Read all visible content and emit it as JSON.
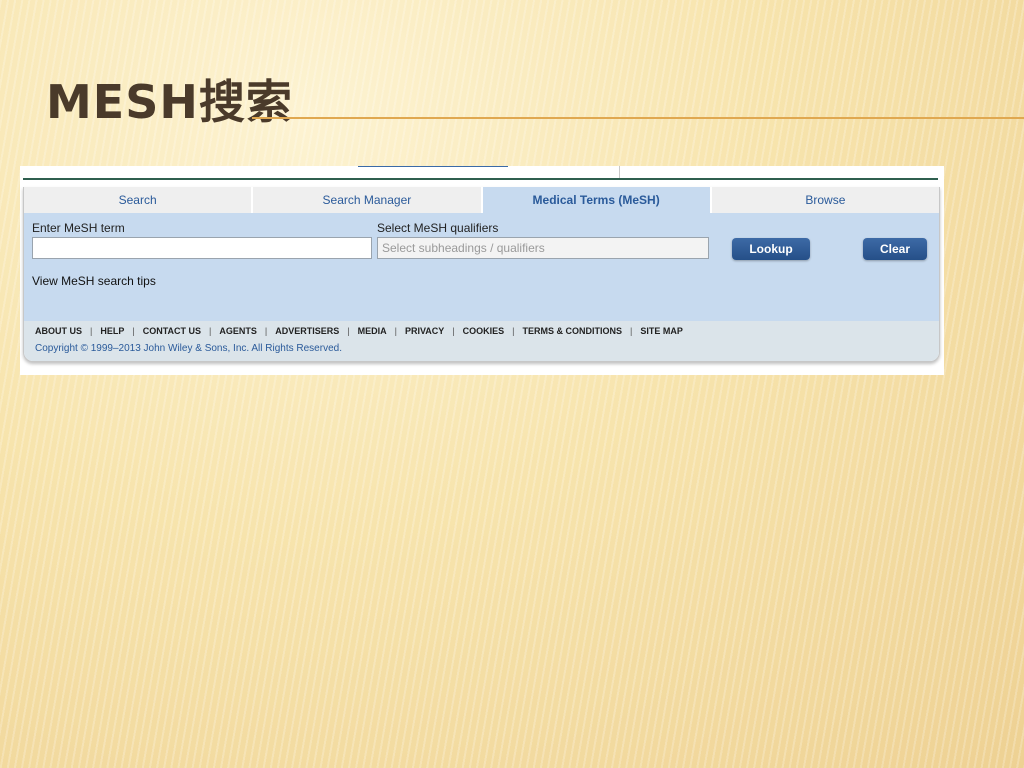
{
  "slide": {
    "title": "MESH搜索"
  },
  "tabs": [
    {
      "label": "Search"
    },
    {
      "label": "Search Manager"
    },
    {
      "label": "Medical Terms (MeSH)"
    },
    {
      "label": "Browse"
    }
  ],
  "form": {
    "term_label": "Enter MeSH term",
    "term_value": "",
    "qualifiers_label": "Select MeSH qualifiers",
    "qualifiers_placeholder": "Select subheadings / qualifiers",
    "lookup_label": "Lookup",
    "clear_label": "Clear",
    "tips_link": "View MeSH search tips"
  },
  "footer": {
    "links": [
      "ABOUT US",
      "HELP",
      "CONTACT US",
      "AGENTS",
      "ADVERTISERS",
      "MEDIA",
      "PRIVACY",
      "COOKIES",
      "TERMS & CONDITIONS",
      "SITE MAP"
    ],
    "copyright": "Copyright © 1999–2013 John Wiley & Sons, Inc. All Rights Reserved."
  },
  "colors": {
    "accent_blue": "#2a5a9a",
    "panel_bg": "#c7daef",
    "button_bg": "#2e5b96",
    "title_rule": "#e0a850",
    "title_text": "#4a3a2a"
  }
}
